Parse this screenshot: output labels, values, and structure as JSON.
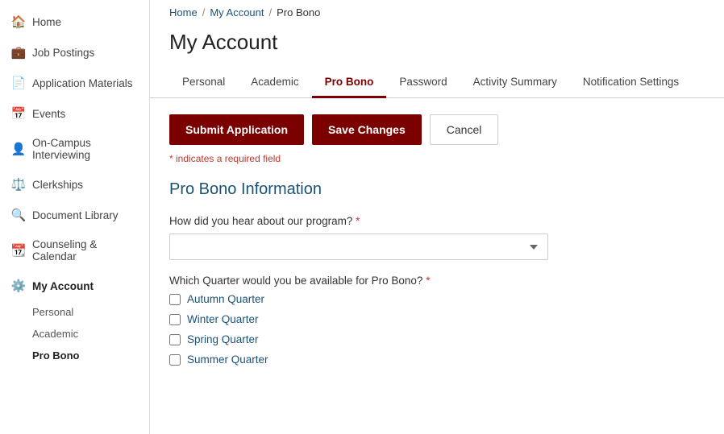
{
  "sidebar": {
    "items": [
      {
        "id": "home",
        "label": "Home",
        "icon": "🏠"
      },
      {
        "id": "job-postings",
        "label": "Job Postings",
        "icon": "💼"
      },
      {
        "id": "application-materials",
        "label": "Application Materials",
        "icon": "📄"
      },
      {
        "id": "events",
        "label": "Events",
        "icon": "📅"
      },
      {
        "id": "on-campus-interviewing",
        "label": "On-Campus Interviewing",
        "icon": "👤"
      },
      {
        "id": "clerkships",
        "label": "Clerkships",
        "icon": "⚖️"
      },
      {
        "id": "document-library",
        "label": "Document Library",
        "icon": "🔍"
      },
      {
        "id": "counseling-calendar",
        "label": "Counseling & Calendar",
        "icon": "📆"
      },
      {
        "id": "my-account",
        "label": "My Account",
        "icon": "⚙️",
        "active": true
      }
    ],
    "sub_items": [
      {
        "id": "personal",
        "label": "Personal"
      },
      {
        "id": "academic",
        "label": "Academic"
      },
      {
        "id": "pro-bono",
        "label": "Pro Bono",
        "active": true
      }
    ]
  },
  "breadcrumb": {
    "items": [
      "Home",
      "My Account",
      "Pro Bono"
    ],
    "separators": "/",
    "home_label": "Home",
    "account_label": "My Account",
    "current_label": "Pro Bono"
  },
  "page": {
    "title": "My Account"
  },
  "tabs": [
    {
      "id": "personal",
      "label": "Personal",
      "active": false
    },
    {
      "id": "academic",
      "label": "Academic",
      "active": false
    },
    {
      "id": "pro-bono",
      "label": "Pro Bono",
      "active": true
    },
    {
      "id": "password",
      "label": "Password",
      "active": false
    },
    {
      "id": "activity-summary",
      "label": "Activity Summary",
      "active": false
    },
    {
      "id": "notification-settings",
      "label": "Notification Settings",
      "active": false
    }
  ],
  "buttons": {
    "submit": "Submit Application",
    "save": "Save Changes",
    "cancel": "Cancel"
  },
  "form": {
    "required_note": "* indicates a required field",
    "required_star": "*",
    "section_title": "Pro Bono Information",
    "hear_label": "How did you hear about our program?",
    "hear_placeholder": "",
    "quarter_label": "Which Quarter would you be available for Pro Bono?",
    "quarter_options": [
      {
        "id": "autumn",
        "label": "Autumn Quarter"
      },
      {
        "id": "winter",
        "label": "Winter Quarter"
      },
      {
        "id": "spring",
        "label": "Spring Quarter"
      },
      {
        "id": "summer",
        "label": "Summer Quarter"
      }
    ],
    "select_options": [
      {
        "value": "",
        "label": ""
      }
    ]
  }
}
